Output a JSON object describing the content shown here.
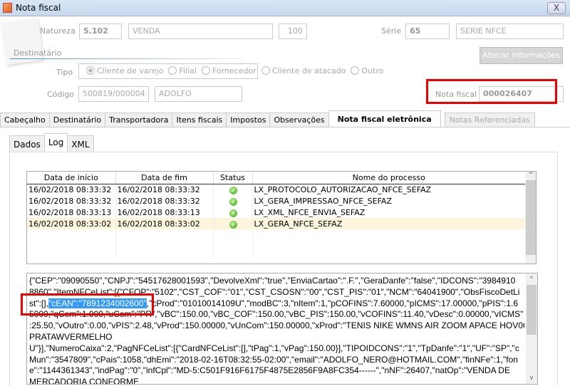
{
  "window": {
    "title": "Nota fiscal",
    "close": "X"
  },
  "header": {
    "natureza_label": "Natureza",
    "natureza_code": "5.102",
    "natureza_desc": "VENDA",
    "natureza_num": "100",
    "serie_label": "Série",
    "serie_code": "65",
    "serie_desc": "SERIE NFCE",
    "destinatario_label": "Destinatário",
    "alterar_button": "Alterar informações",
    "tipo_label": "Tipo",
    "tipo_options": [
      "Cliente de varejo",
      "Filial",
      "Fornecedor",
      "Cliente de atacado",
      "Outro"
    ],
    "tipo_selected": "Cliente de varejo",
    "codigo_label": "Código",
    "codigo_value": "500819/000004",
    "cliente_nome": "ADOLFO",
    "nota_fiscal_label": "Nota fiscal",
    "nota_fiscal_value": "000026407"
  },
  "tabs": [
    "Cabeçalho",
    "Destinatário",
    "Transportadora",
    "Itens fiscais",
    "Impostos",
    "Observações",
    "Nota fiscal eletrônica",
    "Notas Referenciadas"
  ],
  "subtabs": [
    "Dados",
    "Log",
    "XML"
  ],
  "log_table": {
    "columns": [
      "Data de início",
      "Data de fim",
      "Status",
      "Nome do processo"
    ],
    "rows": [
      {
        "inicio": "16/02/2018 08:33:32",
        "fim": "16/02/2018 08:33:32",
        "status": "ok",
        "processo": "LX_PROTOCOLO_AUTORIZACAO_NFCE_SEFAZ"
      },
      {
        "inicio": "16/02/2018 08:33:32",
        "fim": "16/02/2018 08:33:32",
        "status": "ok",
        "processo": "LX_GERA_IMPRESSAO_NFCE_SEFAZ"
      },
      {
        "inicio": "16/02/2018 08:33:13",
        "fim": "16/02/2018 08:33:13",
        "status": "ok",
        "processo": "LX_XML_NFCE_ENVIA_SEFAZ"
      },
      {
        "inicio": "16/02/2018 08:33:02",
        "fim": "16/02/2018 08:33:02",
        "status": "ok",
        "processo": "LX_GERA_NFCE_SEFAZ"
      }
    ]
  },
  "log_text": {
    "line1": "{\"CEP\":\"09090550\",\"CNPJ\":\"54517628001593\",\"DevolveXml\":\"true\",\"EnviaCartao\":\".F.\",\"GeraDanfe\":\"false\",\"IDCONS\":\"3984910",
    "line2": "8860\",\"ItemNFCeList\":[{\"CFOP\":\"5102\",\"CST_COF\":\"01\",\"CST_CSOSN\":\"00\",\"CST_PIS\":\"01\",\"NCM\":\"64041900\",\"ObsFiscoDetLi",
    "line3_pre": "st\":[],",
    "line3_hl": "\"cEAN\":\"7891234002600\"",
    "line3_post": ",\"cProd\":\"01010014109U\",\"modBC\":3,\"nItem\":1,\"pCOFINS\":7.60000,\"pICMS\":17.00000,\"pPIS\":1.6",
    "line4": "5000,\"qCom\":1.000,\"uCom\":\"PR\",\"vBC\":150.00,\"vBC_COF\":150.00,\"vBC_PIS\":150.00,\"vCOFINS\":11.40,\"vDesc\":0.00000,\"vICMS\"",
    "line5": ":25.50,\"vOutro\":0.00,\"vPIS\":2.48,\"vProd\":150.00000,\"vUnCom\":150.00000,\"xProd\":\"TENIS NIKE WMNS AIR ZOOM APACE HOV06",
    "line6": "PRATAWVERMELHO",
    "line7": "U\"}],\"NumeroCaixa\":2,\"PagNFCeList\":[{\"CardNFCeList\":[],\"tPag\":1,\"vPag\":150.00}],\"TIPOIDCONS\":\"1\",\"TpDanfe\":\"1\",\"UF\":\"SP\",\"c",
    "line8": "Mun\":\"3547809\",\"cPais\":1058,\"dhEmi\":\"2018-02-16T08:32:55-02:00\",\"email\":\"ADOLFO_NERO@HOTMAIL.COM\",\"finNFe\":1,\"fon",
    "line9": "e\":\"1144361343\",\"indPag\":\"0\",\"infCpl\":\"MD-5:C501F916F6175F4875E2856F9A8FC354------\",\"nNF\":26407,\"natOp\":\"VENDA DE",
    "line10": "MERCADORIA CONFORME"
  },
  "colors": {
    "highlight": "#3399ff",
    "annotation": "#e00000",
    "selected_row": "#fdf4dc"
  }
}
